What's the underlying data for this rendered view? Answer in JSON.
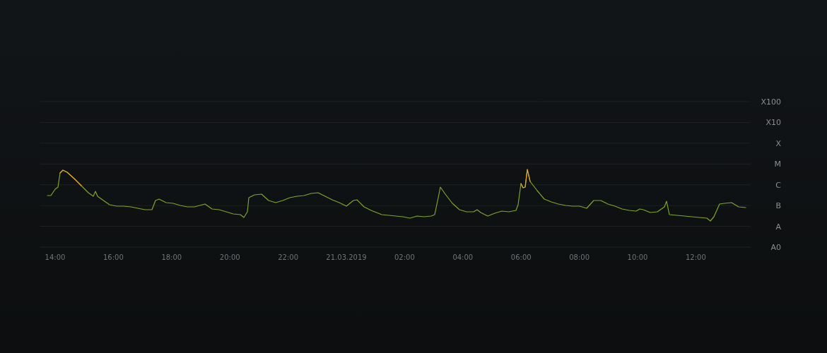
{
  "chart": {
    "y_axis_labels": [
      "X100",
      "X10",
      "X",
      "M",
      "C",
      "B",
      "A",
      "A0"
    ],
    "x_axis_labels": [
      "14:00",
      "16:00",
      "18:00",
      "20:00",
      "22:00",
      "21.03.2019",
      "02:00",
      "04:00",
      "06:00",
      "08:00",
      "10:00",
      "12:00"
    ]
  }
}
